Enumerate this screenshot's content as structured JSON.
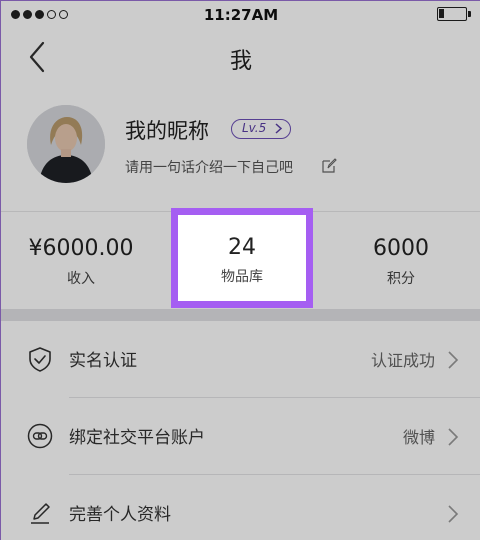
{
  "status_bar": {
    "time": "11:27AM",
    "signal_bars_filled": 3,
    "signal_bars_total": 5,
    "battery_level": 0.2
  },
  "nav": {
    "title": "我",
    "back_icon": "chevron-left-icon"
  },
  "profile": {
    "nickname": "我的昵称",
    "level": "Lv.5",
    "bio": "请用一句话介绍一下自己吧",
    "edit_icon": "edit-icon"
  },
  "stats": [
    {
      "value": "¥6000.00",
      "label": "收入"
    },
    {
      "value": "24",
      "label": "物品库"
    },
    {
      "value": "6000",
      "label": "积分"
    }
  ],
  "highlight_color": "#a55ef2",
  "menu": [
    {
      "label": "实名认证",
      "value": "认证成功",
      "icon": "shield-check-icon"
    },
    {
      "label": "绑定社交平台账户",
      "value": "微博",
      "icon": "link-icon"
    },
    {
      "label": "完善个人资料",
      "value": "",
      "icon": "pencil-icon"
    }
  ]
}
